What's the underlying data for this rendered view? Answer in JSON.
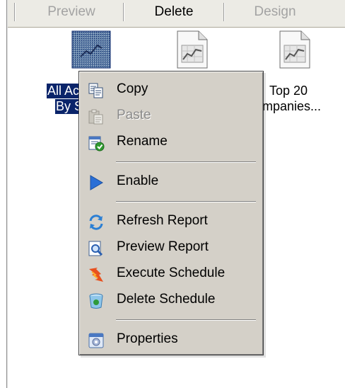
{
  "toolbar": {
    "preview_label": "Preview",
    "delete_label": "Delete",
    "design_label": "Design"
  },
  "reports": [
    {
      "caption_line1": "All Ac",
      "caption_line2": "By S",
      "selected": true
    },
    {
      "caption_line1": "",
      "caption_line2": "",
      "selected": false
    },
    {
      "caption_line1": "Top 20",
      "caption_line2": "mpanies...",
      "selected": false
    }
  ],
  "context_menu": {
    "items": [
      {
        "label": "Copy",
        "icon": "copy-icon",
        "enabled": true
      },
      {
        "label": "Paste",
        "icon": "paste-icon",
        "enabled": false
      },
      {
        "label": "Rename",
        "icon": "rename-icon",
        "enabled": true
      },
      {
        "label": "Enable",
        "icon": "play-icon",
        "enabled": true
      },
      {
        "label": "Refresh Report",
        "icon": "refresh-icon",
        "enabled": true
      },
      {
        "label": "Preview Report",
        "icon": "preview-icon",
        "enabled": true
      },
      {
        "label": "Execute Schedule",
        "icon": "execute-icon",
        "enabled": true
      },
      {
        "label": "Delete Schedule",
        "icon": "recycle-bin-icon",
        "enabled": true
      },
      {
        "label": "Properties",
        "icon": "properties-icon",
        "enabled": true
      }
    ]
  },
  "colors": {
    "selection": "#0a246a",
    "menu_bg": "#d4d0c8",
    "enable_blue": "#2a6fd6"
  }
}
